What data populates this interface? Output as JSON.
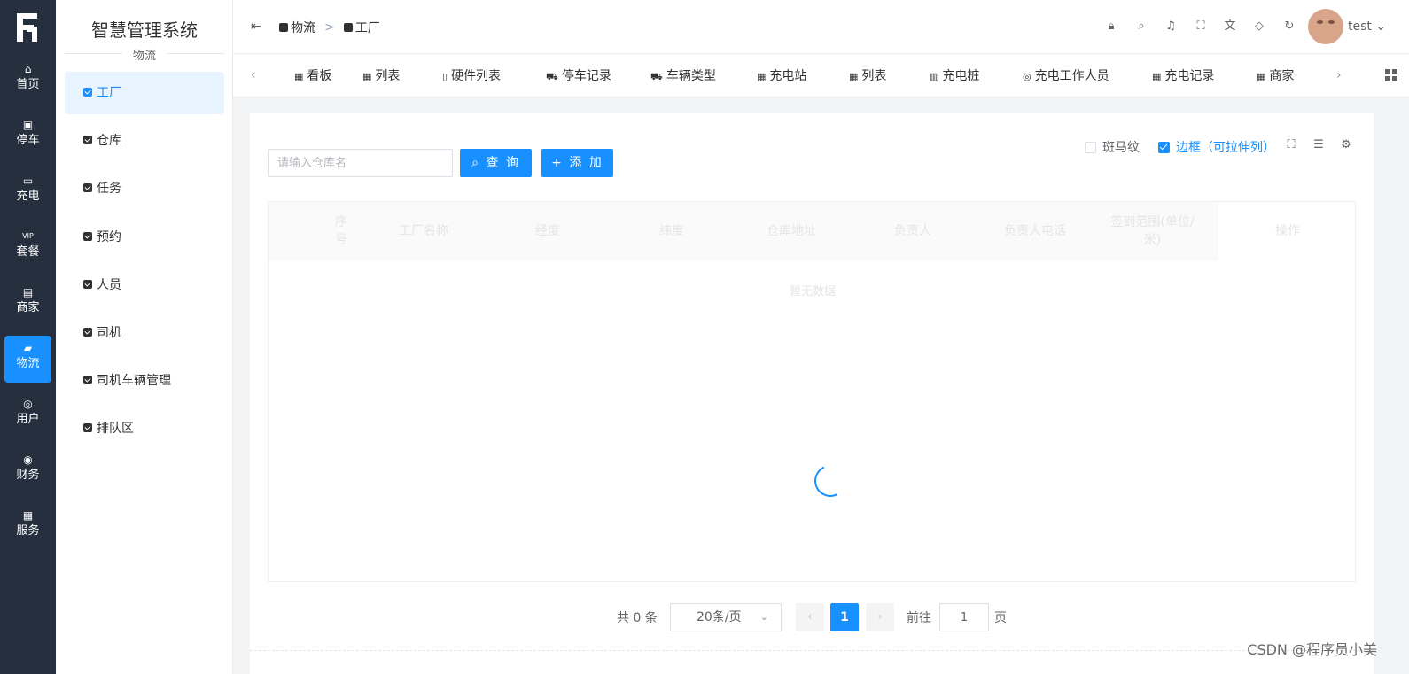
{
  "app": {
    "title": "智慧管理系统",
    "logo_text": "GF"
  },
  "rail": {
    "items": [
      {
        "label": "首页",
        "icon": "home-icon",
        "glyph": "⌂",
        "active": false
      },
      {
        "label": "停车",
        "icon": "parking-icon",
        "glyph": "▣",
        "active": false
      },
      {
        "label": "充电",
        "icon": "charge-icon",
        "glyph": "▭",
        "active": false
      },
      {
        "label": "套餐",
        "icon": "vip-icon",
        "glyph": "VIP",
        "active": false
      },
      {
        "label": "商家",
        "icon": "shop-icon",
        "glyph": "▤",
        "active": false
      },
      {
        "label": "物流",
        "icon": "truck-icon",
        "glyph": "▰",
        "active": true
      },
      {
        "label": "用户",
        "icon": "user-icon",
        "glyph": "◎",
        "active": false
      },
      {
        "label": "财务",
        "icon": "finance-icon",
        "glyph": "◉",
        "active": false
      },
      {
        "label": "服务",
        "icon": "service-icon",
        "glyph": "▦",
        "active": false
      }
    ]
  },
  "submenu": {
    "section": "物流",
    "items": [
      {
        "label": "工厂",
        "active": true
      },
      {
        "label": "仓库",
        "active": false
      },
      {
        "label": "任务",
        "active": false
      },
      {
        "label": "预约",
        "active": false
      },
      {
        "label": "人员",
        "active": false
      },
      {
        "label": "司机",
        "active": false
      },
      {
        "label": "司机车辆管理",
        "active": false
      },
      {
        "label": "排队区",
        "active": false
      }
    ]
  },
  "header": {
    "breadcrumb": [
      "物流",
      "工厂"
    ],
    "separator": ">",
    "tools": [
      "lock-icon",
      "search-icon",
      "bell-icon",
      "fullscreen-icon",
      "translate-icon",
      "theme-icon",
      "refresh-icon"
    ],
    "user": "test"
  },
  "tabs": [
    {
      "label": "看板",
      "icon": "grid-icon"
    },
    {
      "label": "列表",
      "icon": "grid-icon"
    },
    {
      "label": "硬件列表",
      "icon": "doc-icon"
    },
    {
      "label": "停车记录",
      "icon": "car-icon"
    },
    {
      "label": "车辆类型",
      "icon": "car-icon"
    },
    {
      "label": "充电站",
      "icon": "grid-icon"
    },
    {
      "label": "列表",
      "icon": "grid-icon"
    },
    {
      "label": "充电桩",
      "icon": "pile-icon"
    },
    {
      "label": "充电工作人员",
      "icon": "user-icon"
    },
    {
      "label": "充电记录",
      "icon": "grid-icon"
    },
    {
      "label": "商家",
      "icon": "grid-icon"
    }
  ],
  "toolbar": {
    "search_placeholder": "请输入仓库名",
    "query_label": "查 询",
    "add_label": "添 加",
    "stripe_label": "斑马纹",
    "stripe_checked": false,
    "border_label": "边框（可拉伸列）",
    "border_checked": true
  },
  "table": {
    "columns": [
      "序号",
      "工厂名称",
      "经度",
      "纬度",
      "仓库地址",
      "负责人",
      "负责人电话",
      "签到范围(单位/米)",
      "操作"
    ],
    "empty_text": "暂无数据",
    "loading": true
  },
  "pagination": {
    "total_text": "共 0 条",
    "page_size": "20条/页",
    "current_page": "1",
    "goto_label": "前往",
    "goto_value": "1",
    "page_suffix": "页"
  },
  "watermark": "CSDN @程序员小美",
  "colors": {
    "primary": "#1890ff",
    "rail_bg": "#262f3e",
    "content_bg": "#f3f4f6"
  }
}
